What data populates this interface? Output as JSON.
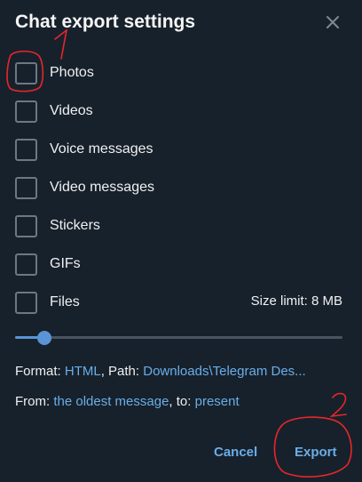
{
  "dialog": {
    "title": "Chat export settings"
  },
  "options": [
    {
      "label": "Photos",
      "checked": false
    },
    {
      "label": "Videos",
      "checked": false
    },
    {
      "label": "Voice messages",
      "checked": false
    },
    {
      "label": "Video messages",
      "checked": false
    },
    {
      "label": "Stickers",
      "checked": false
    },
    {
      "label": "GIFs",
      "checked": false
    },
    {
      "label": "Files",
      "checked": false
    }
  ],
  "size_limit": {
    "text": "Size limit: 8 MB",
    "slider_fraction": 0.09
  },
  "format_line": {
    "format_label": "Format:",
    "format_value": "HTML",
    "sep": ",",
    "path_label": "Path:",
    "path_value": "Downloads\\Telegram Des..."
  },
  "range_line": {
    "from_label": "From:",
    "from_value": "the oldest message",
    "sep": ",",
    "to_label": "to:",
    "to_value": "present"
  },
  "buttons": {
    "cancel": "Cancel",
    "export": "Export"
  },
  "annotations": {
    "mark1": "1",
    "mark2": "2",
    "color": "#e8262a"
  },
  "colors": {
    "background": "#17212b",
    "accent": "#6aaee8",
    "slider": "#5a94d6"
  }
}
